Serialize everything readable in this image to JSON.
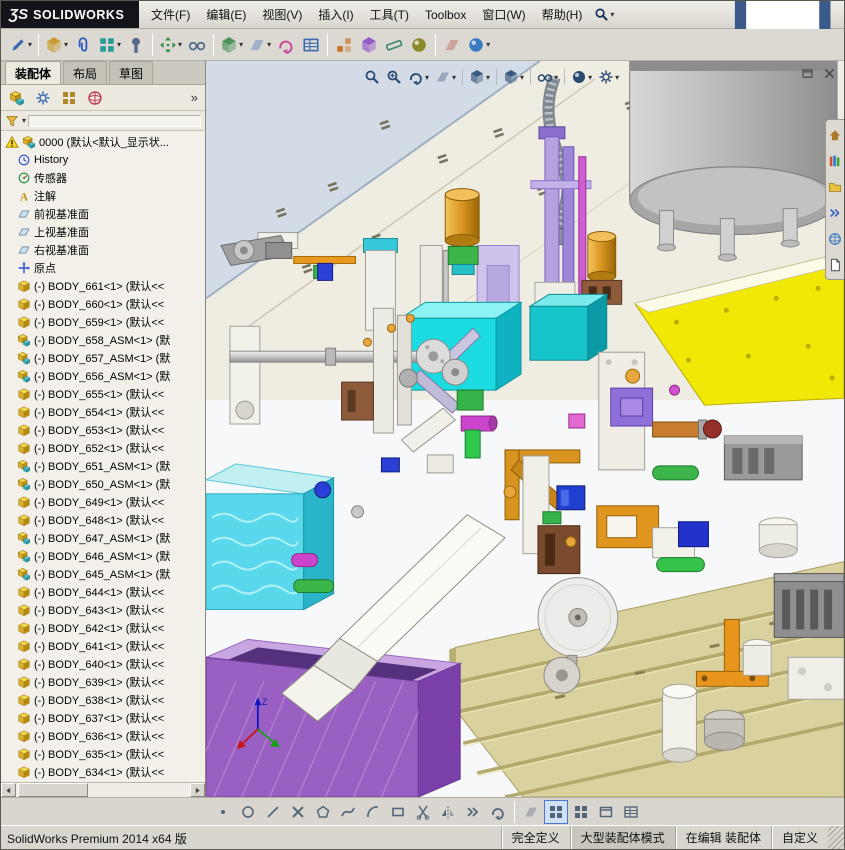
{
  "logo": {
    "glyph": "ƷS",
    "brand": "SOLIDWORKS"
  },
  "menus": [
    {
      "label": "文件(F)"
    },
    {
      "label": "编辑(E)"
    },
    {
      "label": "视图(V)"
    },
    {
      "label": "插入(I)"
    },
    {
      "label": "工具(T)"
    },
    {
      "label": "Toolbox"
    },
    {
      "label": "窗口(W)"
    },
    {
      "label": "帮助(H)"
    }
  ],
  "quick_toolbar": [
    {
      "name": "new-document-icon",
      "sym": "doc",
      "color": "#3a5a8a",
      "caret": true
    },
    {
      "name": "open-icon",
      "sym": "folder",
      "caret": true
    },
    {
      "name": "save-icon",
      "sym": "floppy",
      "caret": true
    },
    {
      "name": "undo-icon",
      "sym": "curvearrow",
      "color": "#2a7a2a"
    },
    {
      "name": "options-icon",
      "sym": "ball",
      "color": "#c03a2a"
    },
    {
      "name": "help-icon",
      "sym": "q",
      "color": "#18305a",
      "caret": true
    }
  ],
  "window_buttons": [
    {
      "name": "minimize-button",
      "sym": "minim"
    },
    {
      "name": "restore-button",
      "sym": "restore"
    },
    {
      "name": "close-button",
      "sym": "x"
    }
  ],
  "assembly_toolbar": [
    {
      "name": "edit-component-icon",
      "sym": "pencil",
      "color": "#3a6ab0",
      "caret": true
    },
    {
      "name": "insert-component-icon",
      "sym": "cube",
      "color": "#c8941e",
      "caret": true,
      "sep": true
    },
    {
      "name": "mate-icon",
      "sym": "clip",
      "color": "#2a5ac8"
    },
    {
      "name": "component-pattern-icon",
      "sym": "grid",
      "color": "#2a9a9a",
      "caret": true
    },
    {
      "name": "smart-fasteners-icon",
      "sym": "bolt",
      "color": "#5a6a8a"
    },
    {
      "name": "move-component-icon",
      "sym": "arrows4",
      "color": "#2a8a3a",
      "caret": true,
      "sep": true
    },
    {
      "name": "show-hidden-components-icon",
      "sym": "glasses",
      "color": "#4a6a8a"
    },
    {
      "name": "assembly-features-icon",
      "sym": "cube",
      "color": "#3a8a4a",
      "caret": true,
      "sep": true
    },
    {
      "name": "reference-geometry-icon",
      "sym": "plane",
      "color": "#3a6ab0",
      "caret": true
    },
    {
      "name": "motion-study-icon",
      "sym": "curvearrow",
      "color": "#c84a9a"
    },
    {
      "name": "bill-of-materials-icon",
      "sym": "table",
      "color": "#3a6ab0"
    },
    {
      "name": "exploded-view-icon",
      "sym": "explode",
      "color": "#c8742a",
      "sep": true
    },
    {
      "name": "interference-detection-icon",
      "sym": "cube",
      "color": "#8a4ac8"
    },
    {
      "name": "measure-icon",
      "sym": "ruler",
      "color": "#3a8a6a"
    },
    {
      "name": "mass-properties-icon",
      "sym": "ball",
      "color": "#8a8a2a"
    },
    {
      "name": "section-view-icon",
      "sym": "plane",
      "color": "#b04a3a",
      "sep": true
    },
    {
      "name": "appearances-icon",
      "sym": "ball",
      "color": "#3a7ac0",
      "caret": true
    }
  ],
  "tabs": [
    {
      "label": "装配体",
      "active": true
    },
    {
      "label": "布局",
      "active": false
    },
    {
      "label": "草图",
      "active": false
    }
  ],
  "panel": {
    "overflow": "»",
    "icons": [
      {
        "name": "featuremanager-icon",
        "sym": "asm"
      },
      {
        "name": "propertymanager-icon",
        "sym": "gear",
        "color": "#3a6ab0"
      },
      {
        "name": "configurationmanager-icon",
        "sym": "grid",
        "color": "#b0882a"
      },
      {
        "name": "dimxpertmanager-icon",
        "sym": "sphere",
        "color": "#c03a5a"
      }
    ]
  },
  "tree": {
    "items": [
      {
        "icon": "root",
        "label": "0000 (默认<默认_显示状..."
      },
      {
        "icon": "history",
        "label": "History"
      },
      {
        "icon": "sensor",
        "label": "传感器"
      },
      {
        "icon": "annot",
        "label": "注解"
      },
      {
        "icon": "plane",
        "label": "前视基准面"
      },
      {
        "icon": "plane",
        "label": "上视基准面"
      },
      {
        "icon": "plane",
        "label": "右视基准面"
      },
      {
        "icon": "origin",
        "label": "原点"
      },
      {
        "icon": "part",
        "label": "(-) BODY_661<1> (默认<<"
      },
      {
        "icon": "part",
        "label": "(-) BODY_660<1> (默认<<"
      },
      {
        "icon": "part",
        "label": "(-) BODY_659<1> (默认<<"
      },
      {
        "icon": "asm",
        "label": "(-) BODY_658_ASM<1> (默"
      },
      {
        "icon": "asm",
        "label": "(-) BODY_657_ASM<1> (默"
      },
      {
        "icon": "asm",
        "label": "(-) BODY_656_ASM<1> (默"
      },
      {
        "icon": "part",
        "label": "(-) BODY_655<1> (默认<<"
      },
      {
        "icon": "part",
        "label": "(-) BODY_654<1> (默认<<"
      },
      {
        "icon": "part",
        "label": "(-) BODY_653<1> (默认<<"
      },
      {
        "icon": "part",
        "label": "(-) BODY_652<1> (默认<<"
      },
      {
        "icon": "asm",
        "label": "(-) BODY_651_ASM<1> (默"
      },
      {
        "icon": "asm",
        "label": "(-) BODY_650_ASM<1> (默"
      },
      {
        "icon": "part",
        "label": "(-) BODY_649<1> (默认<<"
      },
      {
        "icon": "part",
        "label": "(-) BODY_648<1> (默认<<"
      },
      {
        "icon": "asm",
        "label": "(-) BODY_647_ASM<1> (默"
      },
      {
        "icon": "asm",
        "label": "(-) BODY_646_ASM<1> (默"
      },
      {
        "icon": "asm",
        "label": "(-) BODY_645_ASM<1> (默"
      },
      {
        "icon": "part",
        "label": "(-) BODY_644<1> (默认<<"
      },
      {
        "icon": "part",
        "label": "(-) BODY_643<1> (默认<<"
      },
      {
        "icon": "part",
        "label": "(-) BODY_642<1> (默认<<"
      },
      {
        "icon": "part",
        "label": "(-) BODY_641<1> (默认<<"
      },
      {
        "icon": "part",
        "label": "(-) BODY_640<1> (默认<<"
      },
      {
        "icon": "part",
        "label": "(-) BODY_639<1> (默认<<"
      },
      {
        "icon": "part",
        "label": "(-) BODY_638<1> (默认<<"
      },
      {
        "icon": "part",
        "label": "(-) BODY_637<1> (默认<<"
      },
      {
        "icon": "part",
        "label": "(-) BODY_636<1> (默认<<"
      },
      {
        "icon": "part",
        "label": "(-) BODY_635<1> (默认<<"
      },
      {
        "icon": "part",
        "label": "(-) BODY_634<1> (默认<<"
      }
    ]
  },
  "headsup": [
    {
      "name": "zoom-fit-icon",
      "sym": "magnifier"
    },
    {
      "name": "zoom-area-icon",
      "sym": "magplus"
    },
    {
      "name": "previous-view-icon",
      "sym": "curvearrow",
      "caret": true
    },
    {
      "name": "section-view-icon",
      "sym": "plane",
      "caret": true
    },
    {
      "name": "view-orientation-icon",
      "sym": "cube",
      "caret": true,
      "sep": true
    },
    {
      "name": "display-style-icon",
      "sym": "cube",
      "caret": true,
      "sep": true
    },
    {
      "name": "hide-show-items-icon",
      "sym": "glasses",
      "caret": true,
      "sep": true
    },
    {
      "name": "edit-appearance-icon",
      "sym": "ball",
      "caret": true,
      "sep": true
    },
    {
      "name": "view-settings-icon",
      "sym": "gear",
      "caret": true
    }
  ],
  "viewport_controls": [
    {
      "name": "viewport-restore-icon",
      "sym": "frame"
    },
    {
      "name": "viewport-close-icon",
      "sym": "x"
    }
  ],
  "task_pane": [
    {
      "name": "solidworks-resources-icon",
      "sym": "home",
      "color": "#b0782a"
    },
    {
      "name": "design-library-icon",
      "sym": "books"
    },
    {
      "name": "file-explorer-icon",
      "sym": "folder"
    },
    {
      "name": "view-palette-icon",
      "sym": "dblarrow",
      "color": "#2a5ac8"
    },
    {
      "name": "appearances-scenes-icon",
      "sym": "sphere",
      "color": "#3a7ac0"
    },
    {
      "name": "custom-properties-icon",
      "sym": "doc",
      "color": "#5a5a5a"
    }
  ],
  "sketch_toolbar": [
    {
      "name": "sketch-point-icon",
      "sym": "point"
    },
    {
      "name": "sketch-circle-icon",
      "sym": "circle-o"
    },
    {
      "name": "sketch-line-icon",
      "sym": "line-d"
    },
    {
      "name": "sketch-erase-icon",
      "sym": "x"
    },
    {
      "name": "sketch-polygon-icon",
      "sym": "polygon"
    },
    {
      "name": "sketch-spline-icon",
      "sym": "spline"
    },
    {
      "name": "sketch-arc-icon",
      "sym": "arc"
    },
    {
      "name": "sketch-rectangle-icon",
      "sym": "rect-o"
    },
    {
      "name": "sketch-trim-icon",
      "sym": "trim"
    },
    {
      "name": "sketch-mirror-icon",
      "sym": "mirror"
    },
    {
      "name": "sketch-offset-icon",
      "sym": "dblarrow"
    },
    {
      "name": "sketch-convert-icon",
      "sym": "curvearrow"
    },
    {
      "name": "corner-view-icon",
      "sym": "plane",
      "sep": true
    },
    {
      "name": "shaded-sketch-icon",
      "sym": "grid",
      "active": true
    },
    {
      "name": "grid-snap-icon",
      "sym": "grid"
    },
    {
      "name": "viewport-layout-icon",
      "sym": "frame"
    },
    {
      "name": "design-table-icon",
      "sym": "table"
    }
  ],
  "statusbar": {
    "left": "SolidWorks Premium 2014 x64 版",
    "defined": "完全定义",
    "mode": "大型装配体模式",
    "editing": "在编辑 装配体",
    "custom": "自定义"
  },
  "colors": {
    "chrome": "#d9d6cf",
    "tree_bg": "#f2f0e9",
    "accent_blue": "#2a4a72"
  }
}
